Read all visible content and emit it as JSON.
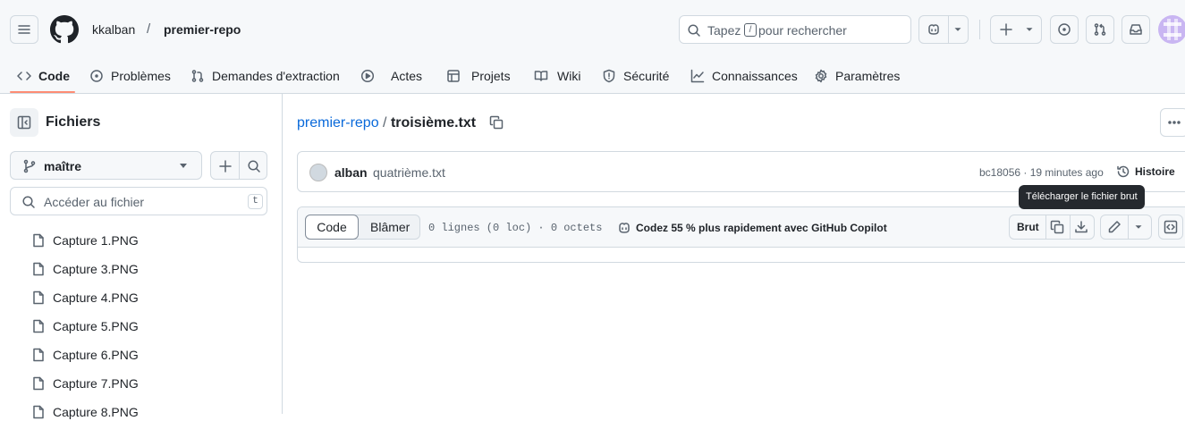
{
  "header": {
    "owner": "kkalban",
    "separator": "/",
    "repo": "premier-repo",
    "search_prefix": "Tapez",
    "search_key": "/",
    "search_suffix": "pour rechercher"
  },
  "tabs": [
    {
      "label": "Code",
      "icon": "code-icon",
      "active": true
    },
    {
      "label": "Problèmes",
      "icon": "issue-icon"
    },
    {
      "label": "Demandes d'extraction",
      "icon": "pull-request-icon"
    },
    {
      "label": "Actes",
      "icon": "play-icon"
    },
    {
      "label": "Projets",
      "icon": "table-icon"
    },
    {
      "label": "Wiki",
      "icon": "book-icon"
    },
    {
      "label": "Sécurité",
      "icon": "shield-icon"
    },
    {
      "label": "Connaissances",
      "icon": "graph-icon"
    },
    {
      "label": "Paramètres",
      "icon": "gear-icon"
    }
  ],
  "sidebar": {
    "title": "Fichiers",
    "branch": "maître",
    "goto_placeholder": "Accéder au fichier",
    "goto_key": "t",
    "files": [
      "Capture 1.PNG",
      "Capture 3.PNG",
      "Capture 4.PNG",
      "Capture 5.PNG",
      "Capture 6.PNG",
      "Capture 7.PNG",
      "Capture 8.PNG"
    ]
  },
  "main": {
    "path_repo": "premier-repo",
    "path_sep": "/",
    "file_name": "troisième.txt",
    "commit": {
      "author": "alban",
      "message": "quatrième.txt",
      "sha_time": "bc18056 · 19 minutes ago",
      "history": "Histoire"
    },
    "tooltip": "Télécharger le fichier brut",
    "viewer": {
      "tab_code": "Code",
      "tab_blame": "Blâmer",
      "meta": "0 lignes (0 loc) · 0 octets",
      "copilot": "Codez 55 % plus rapidement avec GitHub Copilot",
      "raw": "Brut"
    }
  },
  "colors": {
    "accent_underline": "#fd8c73",
    "link": "#0969da"
  }
}
